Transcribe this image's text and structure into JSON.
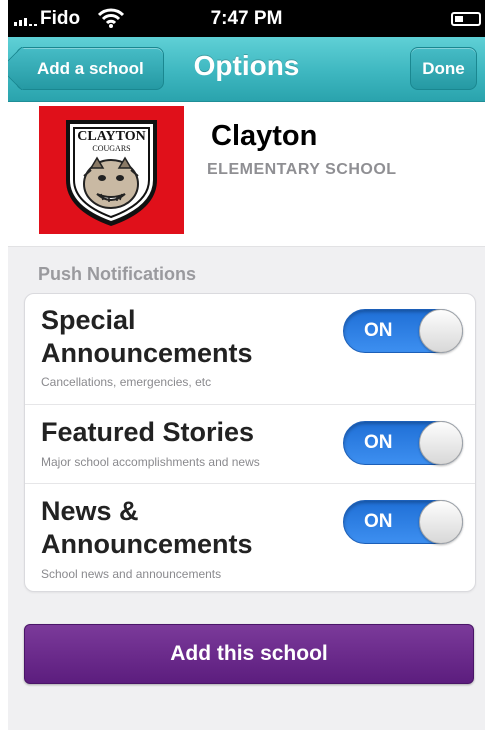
{
  "status_bar": {
    "carrier": "Fido",
    "time": "7:47 PM"
  },
  "nav_bar": {
    "back_label": "Add a school",
    "title": "Options",
    "done_label": "Done"
  },
  "school": {
    "name": "Clayton",
    "type": "ELEMENTARY SCHOOL",
    "logo_text_top": "CLAYTON",
    "logo_text_sub": "COUGARS"
  },
  "push_notifications": {
    "title": "Push Notifications",
    "items": [
      {
        "title_line1": "Special",
        "title_line2": "Announcements",
        "subtitle": "Cancellations, emergencies, etc",
        "toggle_label": "ON",
        "enabled": true
      },
      {
        "title_line1": "Featured Stories",
        "title_line2": "",
        "subtitle": "Major school accomplishments and news",
        "toggle_label": "ON",
        "enabled": true
      },
      {
        "title_line1": "News &",
        "title_line2": "Announcements",
        "subtitle": "School news and announcements",
        "toggle_label": "ON",
        "enabled": true
      }
    ]
  },
  "add_button_label": "Add this school",
  "colors": {
    "nav_teal": "#3eb7c0",
    "toggle_blue": "#2d7fe6",
    "add_purple": "#6a2a8c",
    "logo_red": "#e0101a"
  }
}
